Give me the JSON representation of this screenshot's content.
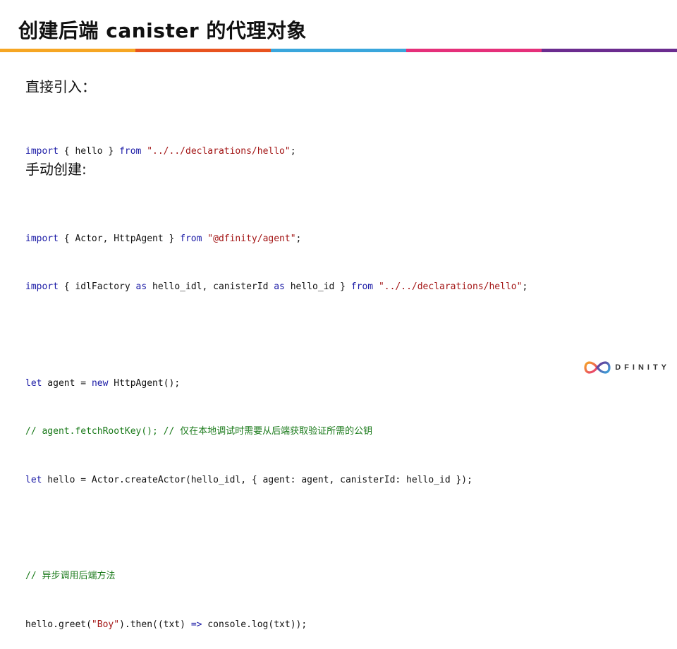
{
  "slide": {
    "title": "创建后端 canister 的代理对象",
    "section1_heading": "直接引入：",
    "section2_heading": "手动创建:"
  },
  "colors": {
    "accent_bar": [
      "#f6a623",
      "#e8531f",
      "#3aa6dc",
      "#e5307a",
      "#6b2c8f"
    ],
    "keyword": "#1a1aa6",
    "string": "#a31515",
    "comment": "#1a7a1a"
  },
  "code1": {
    "l1": {
      "import_kw": "import",
      "braces": " { hello } ",
      "from_kw": "from",
      "sp": " ",
      "path": "\"../../declarations/hello\"",
      "end": ";"
    }
  },
  "code2": {
    "l1": {
      "import_kw": "import",
      "mid": " { Actor, HttpAgent } ",
      "from_kw": "from",
      "sp": " ",
      "path": "\"@dfinity/agent\"",
      "end": ";"
    },
    "l2": {
      "import_kw": "import",
      "a": " { idlFactory ",
      "as1": "as",
      "b": " hello_idl, canisterId ",
      "as2": "as",
      "c": " hello_id } ",
      "from_kw": "from",
      "sp": " ",
      "path": "\"../../declarations/hello\"",
      "end": ";"
    },
    "l3": {
      "let_kw": "let",
      "a": " agent = ",
      "new_kw": "new",
      "b": " HttpAgent();"
    },
    "l4": {
      "comment": "// agent.fetchRootKey(); // 仅在本地调试时需要从后端获取验证所需的公钥"
    },
    "l5": {
      "let_kw": "let",
      "a": " hello = Actor.createActor(hello_idl, { agent: agent, canisterId: hello_id });"
    },
    "l6": {
      "comment": "// 异步调用后端方法"
    },
    "l7": {
      "a": "hello.greet(",
      "str": "\"Boy\"",
      "b": ").then((txt) ",
      "arrow": "=>",
      "c": " console.log(txt));"
    }
  },
  "logo": {
    "text": "DFINITY",
    "icon": "infinity-logo-icon"
  }
}
